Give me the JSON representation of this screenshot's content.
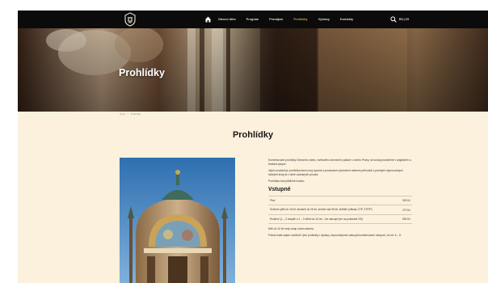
{
  "nav": {
    "items": [
      "Obecní dům",
      "Program",
      "Pronájem",
      "Prohlídky",
      "Výstavy",
      "Kontakty"
    ],
    "active_index": 3,
    "lang": "EN | CS",
    "icons": {
      "logo": "crest-logo-icon",
      "home": "home-icon",
      "search": "search-icon"
    }
  },
  "hero": {
    "title": "Prohlídky"
  },
  "breadcrumb": [
    "Úvod",
    "/",
    "Prohlídky"
  ],
  "page": {
    "title": "Prohlídky"
  },
  "intro": [
    "Komentované prohlídky Obecního domu, světového secesního paláce v centru Prahy, se konají pravidelně v anglickém a českém jazyce.",
    "Jejich součástí je prohlídka demi nosy sparné a prostorách východem reálném průvodců s pestrými doprovodnými dobrými texty ał v okně uzávaných prostor.",
    "Prohlídka trvá přibližně hodinu."
  ],
  "pricing": {
    "heading": "Vstupné",
    "rows": [
      {
        "label": "Plné",
        "price": "330 Kč"
      },
      {
        "label": "Snížené (děti do 16 let, studenti do 26 let, senioři nad 65 let, držitelé průkazu ZTP, ZTP/P)",
        "price": "270 Kč"
      },
      {
        "label": "Rodinné (1 – 2 dospělí a 1 – 3 dětmi do 16 let – lze zakoupit jen na pokladně OD)",
        "price": "690 Kč"
      }
    ]
  },
  "notes": [
    "Děti do 10 let mají vstup zcela zdarma.",
    "Pokud máte zájem navštívit i jiné prohlídky i výstavy, doporučujeme zakoupit kombinované vstupné, viz str. 6 – 8."
  ],
  "colors": {
    "nav_bg": "#0b0b0b",
    "page_bg": "#fbf1dd",
    "accent": "#d7a54a"
  }
}
